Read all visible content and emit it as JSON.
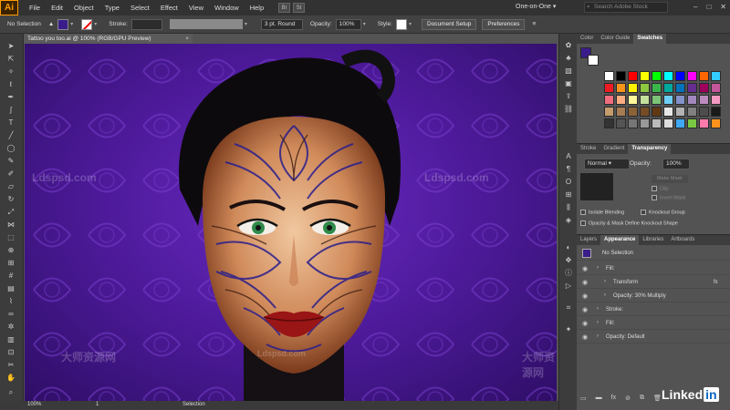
{
  "app": {
    "logo": "Ai",
    "menu": [
      "File",
      "Edit",
      "Object",
      "Type",
      "Select",
      "Effect",
      "View",
      "Window",
      "Help"
    ],
    "bridge_icons": [
      "Br",
      "St"
    ],
    "workspace": "One-on-One",
    "stock_search_placeholder": "Search Adobe Stock",
    "window_buttons": [
      "–",
      "□",
      "✕"
    ]
  },
  "control_bar": {
    "selection_label": "No Selection",
    "fill_color": "#3a1d8a",
    "stroke_label": "Stroke:",
    "brush_label": "3 pt. Round",
    "opacity_label": "Opacity:",
    "opacity_value": "100%",
    "style_label": "Style:",
    "document_setup_label": "Document Setup",
    "preferences_label": "Preferences"
  },
  "document": {
    "tab_title": "Tattoo you too.ai @ 100% (RGB/GPU Preview)",
    "close_glyph": "×"
  },
  "canvas": {
    "background_color": "#5a22ac",
    "watermarks": [
      "Ldspsd.com",
      "Ldspsd.com",
      "大师资源网",
      "大师资源网",
      "Ldspsd.com"
    ]
  },
  "status_bar": {
    "zoom": "100%",
    "page": "1",
    "mode": "Selection"
  },
  "swatches_panel": {
    "tabs": [
      "Color",
      "Color Guide",
      "Swatches"
    ],
    "active_tab": "Swatches",
    "colors": [
      [
        "#ffffff",
        "#000000",
        "#ff0000",
        "#ffff00",
        "#00ff00",
        "#00ffff",
        "#0000ff",
        "#ff00ff",
        "#ff6600",
        "#33ccff"
      ],
      [
        "#ed1c24",
        "#f7941d",
        "#fff200",
        "#8dc63f",
        "#39b54a",
        "#00a99d",
        "#0072bc",
        "#662d91",
        "#9e005d",
        "#c4569b"
      ],
      [
        "#f26d7d",
        "#f9ad81",
        "#fff799",
        "#c4df9b",
        "#7cc576",
        "#6dcff6",
        "#8393ca",
        "#a187be",
        "#bc8cbf",
        "#f49ac2"
      ],
      [
        "#c69c6d",
        "#a67c52",
        "#8c6239",
        "#754c24",
        "#603913",
        "#e6e6e6",
        "#b3b3b3",
        "#808080",
        "#4d4d4d",
        "#1a1a1a"
      ],
      [
        "#333333",
        "#555555",
        "#777777",
        "#999999",
        "#bbbbbb",
        "#dddddd",
        "#3fa9f5",
        "#7ac943",
        "#ff7bac",
        "#ff931e"
      ]
    ]
  },
  "transparency_panel": {
    "tabs": [
      "Stroke",
      "Gradient",
      "Transparency"
    ],
    "active_tab": "Transparency",
    "blend_mode": "Normal",
    "opacity_label": "Opacity:",
    "opacity_value": "100%",
    "make_mask_label": "Make Mask",
    "clip_label": "Clip",
    "invert_mask_label": "Invert Mask",
    "isolate_blending_label": "Isolate Blending",
    "knockout_group_label": "Knockout Group",
    "opacity_mask_label": "Opacity & Mask Define Knockout Shape"
  },
  "appearance_panel": {
    "tabs": [
      "Layers",
      "Appearance",
      "Libraries",
      "Artboards"
    ],
    "active_tab": "Appearance",
    "selection": "No Selection",
    "rows": [
      {
        "label": "Fill:",
        "indent": 1
      },
      {
        "label": "Transform",
        "indent": 2,
        "fx": true
      },
      {
        "label": "Opacity: 30% Multiply",
        "indent": 2
      },
      {
        "label": "Stroke:",
        "indent": 1
      },
      {
        "label": "Fill:",
        "indent": 1
      },
      {
        "label": "Opacity: Default",
        "indent": 1
      }
    ]
  },
  "brand": {
    "linkedin_text": "Linked",
    "linkedin_in": "in"
  }
}
